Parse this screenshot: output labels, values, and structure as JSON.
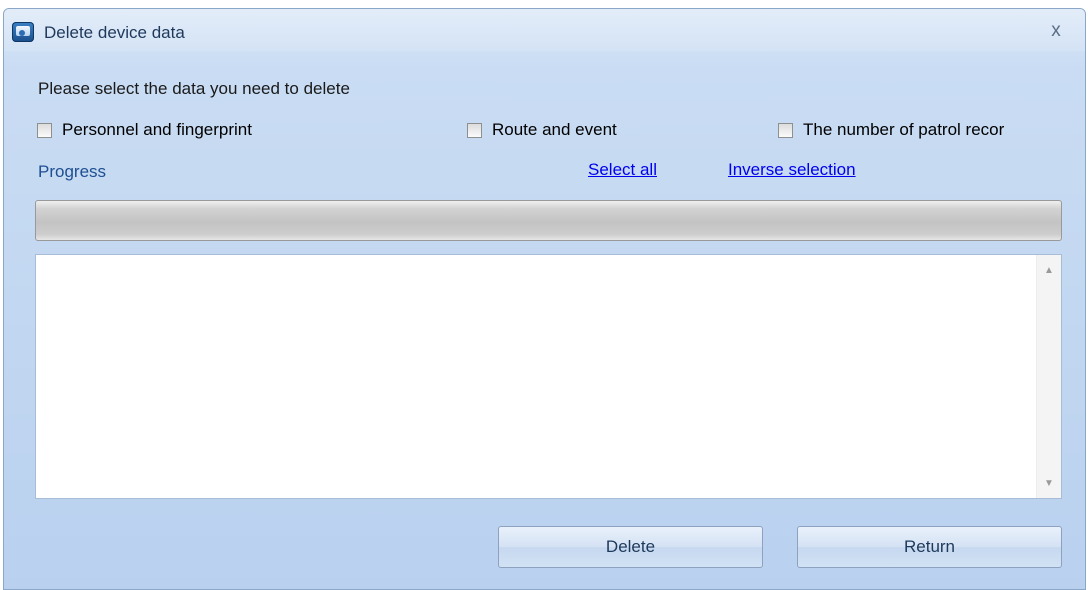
{
  "window": {
    "title": "Delete device data",
    "close_label": "x"
  },
  "prompt": "Please select the data you need to delete",
  "options": [
    {
      "label": "Personnel and fingerprint",
      "checked": false
    },
    {
      "label": "Route and event",
      "checked": false
    },
    {
      "label": "The number of patrol recor",
      "checked": false
    }
  ],
  "progress": {
    "label": "Progress",
    "value": 0
  },
  "links": {
    "select_all": "Select all",
    "inverse_selection": "Inverse selection"
  },
  "log": {
    "content": ""
  },
  "buttons": {
    "delete": "Delete",
    "return": "Return"
  }
}
